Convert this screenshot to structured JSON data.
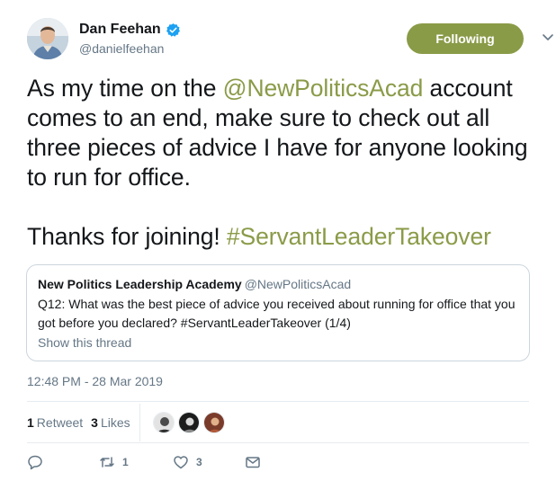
{
  "author": {
    "display_name": "Dan Feehan",
    "handle": "@danielfeehan",
    "verified_icon": "verified-badge-icon"
  },
  "follow_button": {
    "label": "Following",
    "color": "#8a9b48"
  },
  "tweet": {
    "line1_prefix": "As my time on the ",
    "mention": "@NewPoliticsAcad",
    "line1_suffix": " account comes to an end, make sure to check out all three pieces of advice I have for anyone looking to run for office.",
    "line2_prefix": "Thanks for joining! ",
    "hashtag": "#ServantLeaderTakeover",
    "link_color": "#8a9b48"
  },
  "quoted_tweet": {
    "name": "New Politics Leadership Academy",
    "handle": "@NewPoliticsAcad",
    "text": "Q12: What was the best piece of advice you received about running for office that you got before you declared? #ServantLeaderTakeover (1/4)",
    "show_thread": "Show this thread"
  },
  "timestamp": "12:48 PM - 28 Mar 2019",
  "stats": {
    "retweets_count": "1",
    "retweets_label": "Retweet",
    "likes_count": "3",
    "likes_label": "Likes"
  },
  "actions": {
    "reply_icon": "reply-icon",
    "retweet_icon": "retweet-icon",
    "retweet_count": "1",
    "like_icon": "heart-icon",
    "like_count": "3",
    "dm_icon": "envelope-icon"
  }
}
